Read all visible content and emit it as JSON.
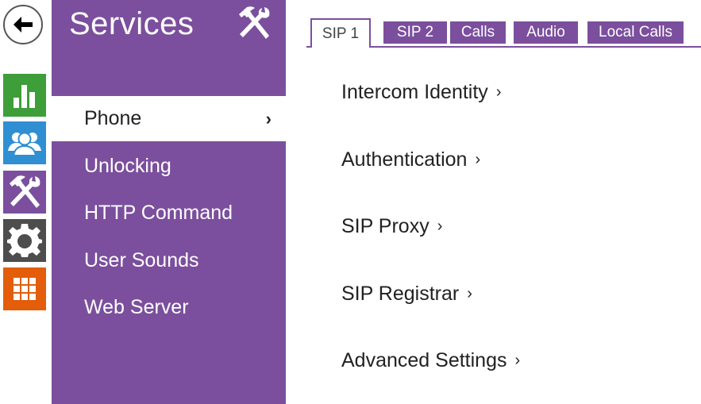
{
  "nav": {
    "back_icon": "arrow-left-icon",
    "tiles": [
      {
        "name": "status",
        "icon": "bar-chart-icon",
        "color": "#3e9e3a"
      },
      {
        "name": "directory",
        "icon": "users-icon",
        "color": "#2f8fd2"
      },
      {
        "name": "services",
        "icon": "hammer-wrench-icon",
        "color": "#7b4f9d"
      },
      {
        "name": "hardware",
        "icon": "gear-icon",
        "color": "#4d4d4d"
      },
      {
        "name": "system",
        "icon": "grid-icon",
        "color": "#e35d0a"
      }
    ]
  },
  "panel": {
    "title": "Services",
    "title_icon": "hammer-wrench-icon",
    "color": "#7b4f9d",
    "menu": [
      {
        "label": "Phone",
        "active": true,
        "chevron": "›"
      },
      {
        "label": "Unlocking",
        "active": false
      },
      {
        "label": "HTTP Command",
        "active": false
      },
      {
        "label": "User Sounds",
        "active": false
      },
      {
        "label": "Web Server",
        "active": false
      }
    ]
  },
  "tabs": [
    {
      "label": "SIP 1",
      "active": true
    },
    {
      "label": "SIP 2",
      "active": false
    },
    {
      "label": "Calls",
      "active": false
    },
    {
      "label": "Audio",
      "active": false
    },
    {
      "label": "Local Calls",
      "active": false
    }
  ],
  "sections": [
    {
      "label": "Intercom Identity",
      "arrow": "›"
    },
    {
      "label": "Authentication",
      "arrow": "›"
    },
    {
      "label": "SIP Proxy",
      "arrow": "›"
    },
    {
      "label": "SIP Registrar",
      "arrow": "›"
    },
    {
      "label": "Advanced Settings",
      "arrow": "›"
    }
  ]
}
